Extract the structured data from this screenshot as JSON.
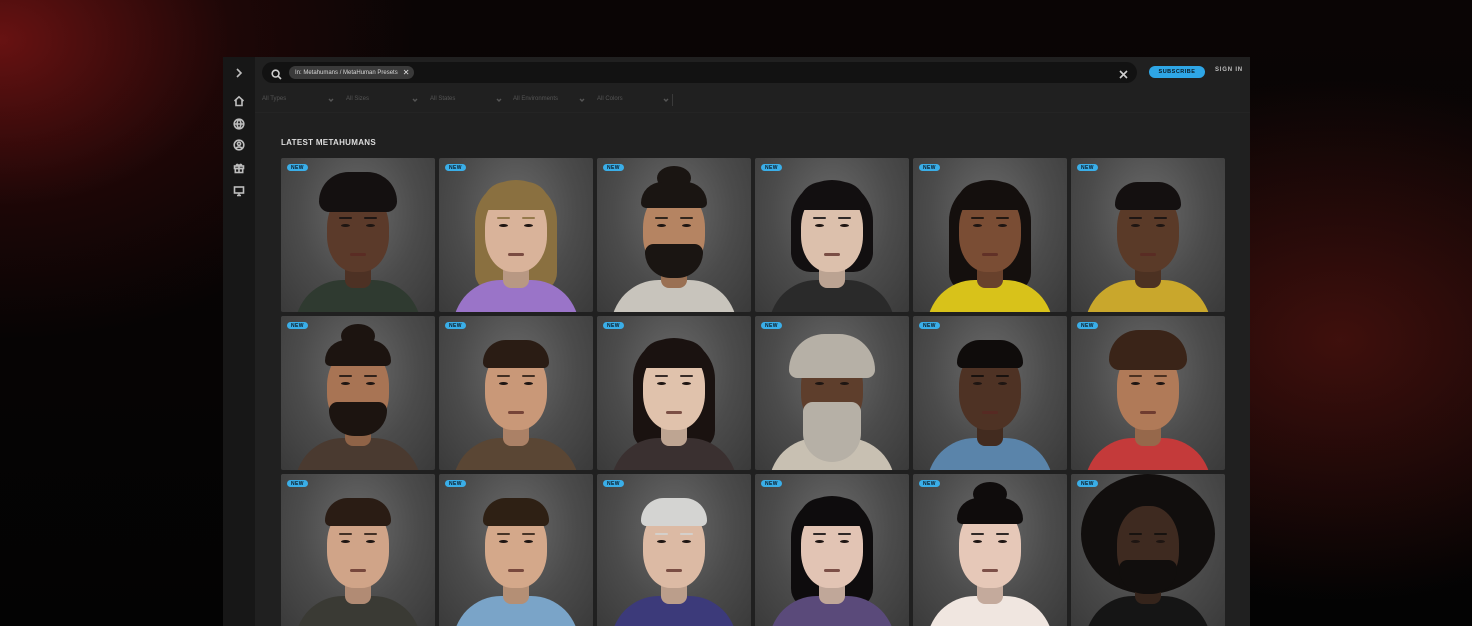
{
  "search": {
    "chip_label": "In: Metahumans / MetaHuman Presets"
  },
  "header": {
    "subscribe_label": "SUBSCRIBE",
    "signin_label": "SIGN IN"
  },
  "sidebar": {
    "items": [
      {
        "icon": "chevron-right-icon"
      },
      {
        "icon": "home-icon"
      },
      {
        "icon": "globe-icon"
      },
      {
        "icon": "user-circle-icon"
      },
      {
        "icon": "gift-icon"
      },
      {
        "icon": "monitor-icon"
      }
    ]
  },
  "filters": [
    {
      "label": "All Types"
    },
    {
      "label": "All Sizes"
    },
    {
      "label": "All States"
    },
    {
      "label": "All Environments"
    },
    {
      "label": "All Colors"
    }
  ],
  "section": {
    "title": "LATEST METAHUMANS"
  },
  "cards": [
    {
      "badge": "NEW",
      "skin": "#5b3a2a",
      "hair": "#141010",
      "shirt": "#2f3a30",
      "hairStyle": "curly"
    },
    {
      "badge": "NEW",
      "skin": "#d9b39a",
      "hair": "#8a7040",
      "shirt": "#9a74c8",
      "hairStyle": "long"
    },
    {
      "badge": "NEW",
      "skin": "#b58462",
      "hair": "#1a1512",
      "shirt": "#c8c4bc",
      "hairStyle": "bun-beard"
    },
    {
      "badge": "NEW",
      "skin": "#dcc0ac",
      "hair": "#120f10",
      "shirt": "#2a2a2a",
      "hairStyle": "bob"
    },
    {
      "badge": "NEW",
      "skin": "#7a4d34",
      "hair": "#140f0d",
      "shirt": "#d8c21a",
      "hairStyle": "long"
    },
    {
      "badge": "NEW",
      "skin": "#5a3a28",
      "hair": "#141010",
      "shirt": "#c9a72c",
      "hairStyle": "short"
    },
    {
      "badge": "NEW",
      "skin": "#a87454",
      "hair": "#1c1410",
      "shirt": "#4a3a30",
      "hairStyle": "bun-beard"
    },
    {
      "badge": "NEW",
      "skin": "#c99878",
      "hair": "#2a1c14",
      "shirt": "#5a4634",
      "hairStyle": "short"
    },
    {
      "badge": "NEW",
      "skin": "#e0c2ac",
      "hair": "#1a1210",
      "shirt": "#3a3030",
      "hairStyle": "long"
    },
    {
      "badge": "NEW",
      "skin": "#5e3e2c",
      "hair": "#b6b0a6",
      "shirt": "#c8c0b2",
      "hairStyle": "elder-beard"
    },
    {
      "badge": "NEW",
      "skin": "#4e3224",
      "hair": "#0f0c0b",
      "shirt": "#5a84aa",
      "hairStyle": "short"
    },
    {
      "badge": "NEW",
      "skin": "#b07a58",
      "hair": "#3a2418",
      "shirt": "#c43a3a",
      "hairStyle": "curly"
    },
    {
      "badge": "NEW",
      "skin": "#d0a488",
      "hair": "#2a1c14",
      "shirt": "#3a3a34",
      "hairStyle": "short"
    },
    {
      "badge": "NEW",
      "skin": "#d4a88a",
      "hair": "#2e2014",
      "shirt": "#7aa4c8",
      "hairStyle": "short"
    },
    {
      "badge": "NEW",
      "skin": "#dcbaa4",
      "hair": "#d4d4d2",
      "shirt": "#3c3a7a",
      "hairStyle": "short-gray"
    },
    {
      "badge": "NEW",
      "skin": "#e2c4b4",
      "hair": "#0e0c0d",
      "shirt": "#5a4a7a",
      "hairStyle": "long"
    },
    {
      "badge": "NEW",
      "skin": "#e6c8b8",
      "hair": "#0f0c0c",
      "shirt": "#f0e6e0",
      "hairStyle": "bun"
    },
    {
      "badge": "NEW",
      "skin": "#3e2a20",
      "hair": "#110e0d",
      "shirt": "#151515",
      "hairStyle": "afro-beard"
    }
  ]
}
